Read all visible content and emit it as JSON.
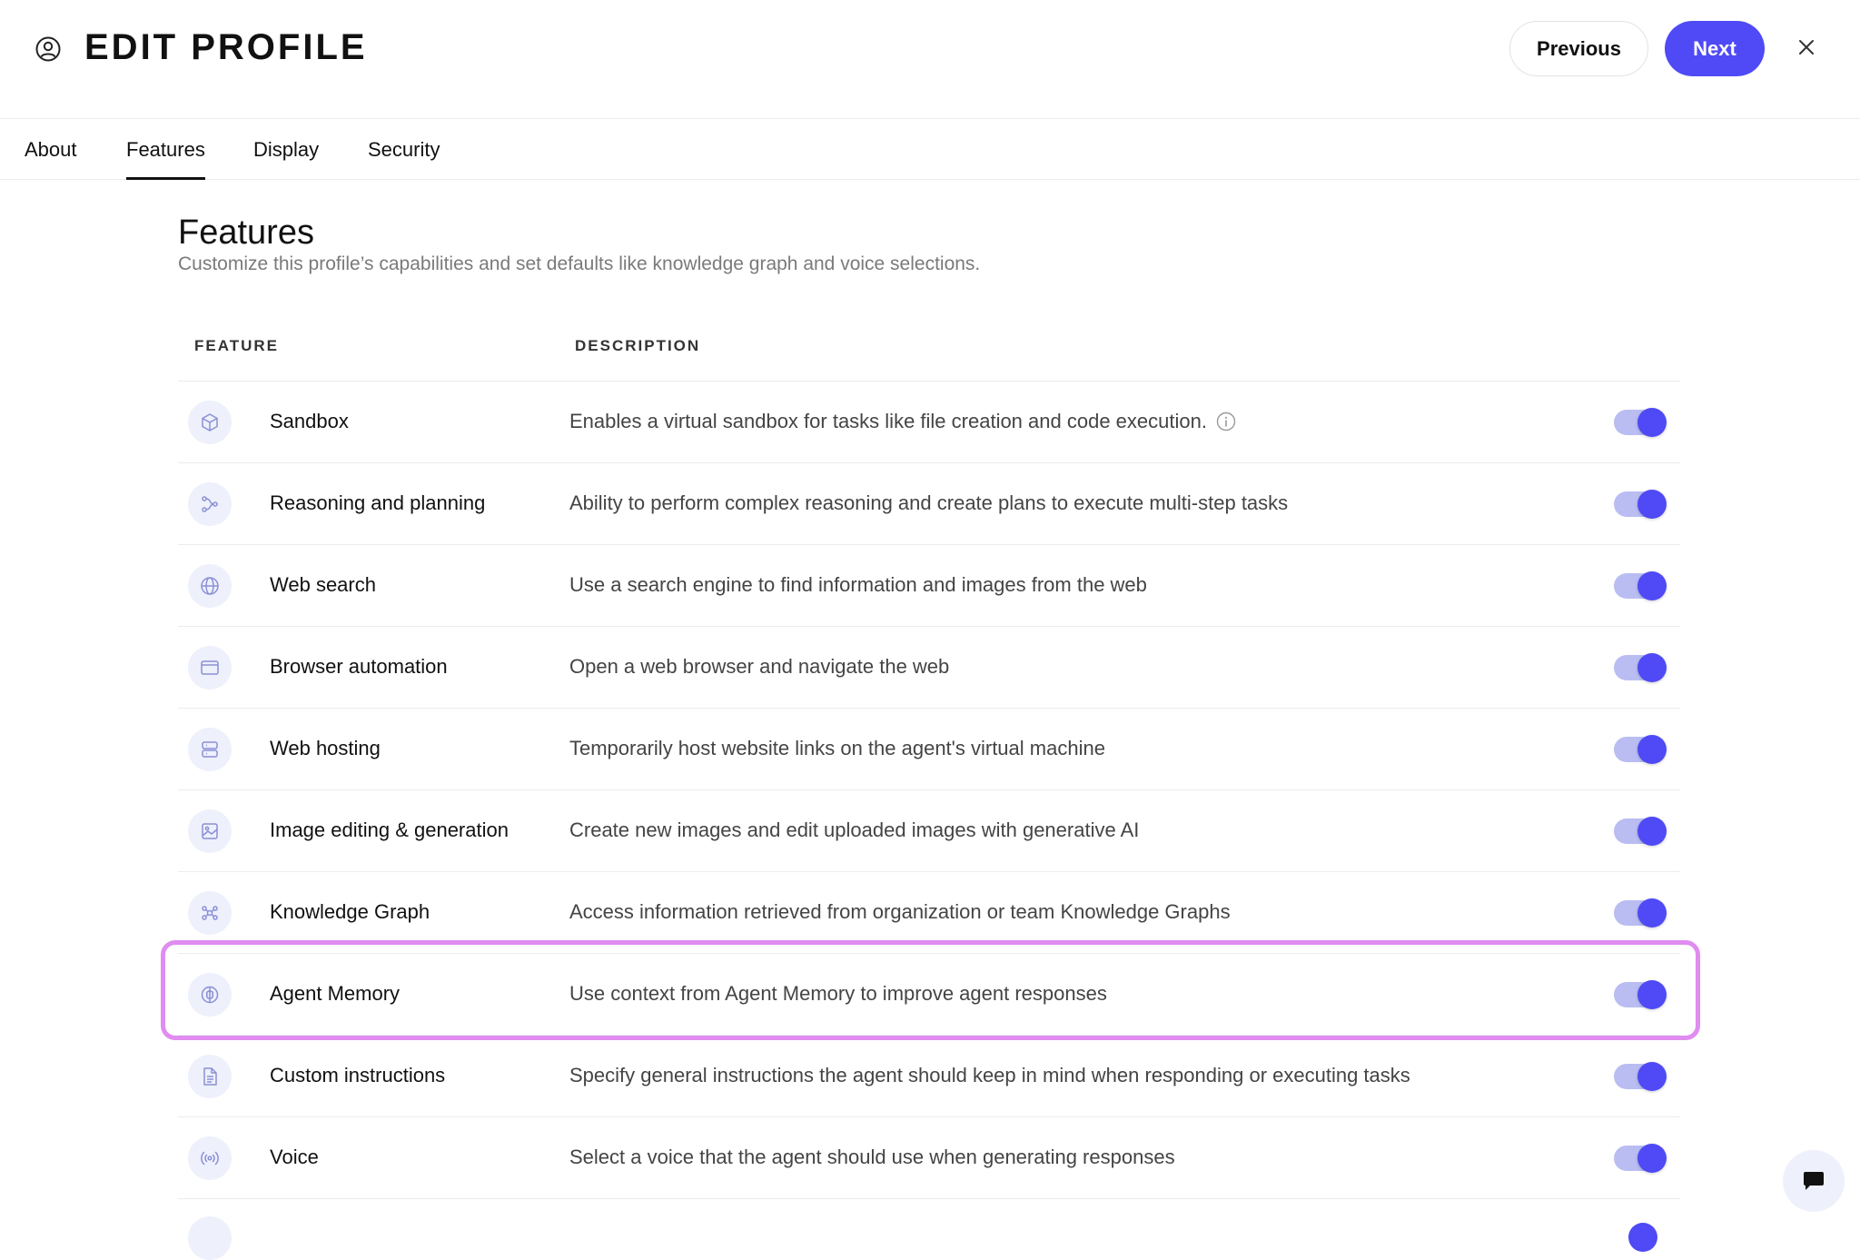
{
  "header": {
    "title": "EDIT PROFILE",
    "previous_label": "Previous",
    "next_label": "Next"
  },
  "tabs": [
    {
      "label": "About",
      "active": false
    },
    {
      "label": "Features",
      "active": true
    },
    {
      "label": "Display",
      "active": false
    },
    {
      "label": "Security",
      "active": false
    }
  ],
  "section": {
    "title": "Features",
    "subtitle": "Customize this profile’s capabilities and set defaults like knowledge graph and voice selections."
  },
  "table": {
    "col_feature": "FEATURE",
    "col_description": "DESCRIPTION",
    "rows": [
      {
        "name": "Sandbox",
        "description": "Enables a virtual sandbox for tasks like file creation and code execution.",
        "icon": "cube-icon",
        "enabled": true
      },
      {
        "name": "Reasoning and planning",
        "description": "Ability to perform complex reasoning and create plans to execute multi-step tasks",
        "icon": "flow-icon",
        "enabled": true
      },
      {
        "name": "Web search",
        "description": "Use a search engine to find information and images from the web",
        "icon": "globe-icon",
        "enabled": true
      },
      {
        "name": "Browser automation",
        "description": "Open a web browser and navigate the web",
        "icon": "browser-window-icon",
        "enabled": true
      },
      {
        "name": "Web hosting",
        "description": "Temporarily host website links on the agent's virtual machine",
        "icon": "server-icon",
        "enabled": true
      },
      {
        "name": "Image editing & generation",
        "description": "Create new images and edit uploaded images with generative AI",
        "icon": "image-icon",
        "enabled": true
      },
      {
        "name": "Knowledge Graph",
        "description": "Access information retrieved from organization or team Knowledge Graphs",
        "icon": "graph-nodes-icon",
        "enabled": true
      },
      {
        "name": "Agent Memory",
        "description": "Use context from Agent Memory to improve agent responses",
        "icon": "brain-icon",
        "enabled": true
      },
      {
        "name": "Custom instructions",
        "description": "Specify general instructions the agent should keep in mind when responding or executing tasks",
        "icon": "document-icon",
        "enabled": true
      },
      {
        "name": "Voice",
        "description": "Select a voice that the agent should use when generating responses",
        "icon": "broadcast-icon",
        "enabled": true
      }
    ]
  },
  "colors": {
    "accent": "#4f4af6",
    "toggle_track": "#b9bdf2",
    "icon_bg": "#eef0fb",
    "highlight": "#e08cf0"
  }
}
